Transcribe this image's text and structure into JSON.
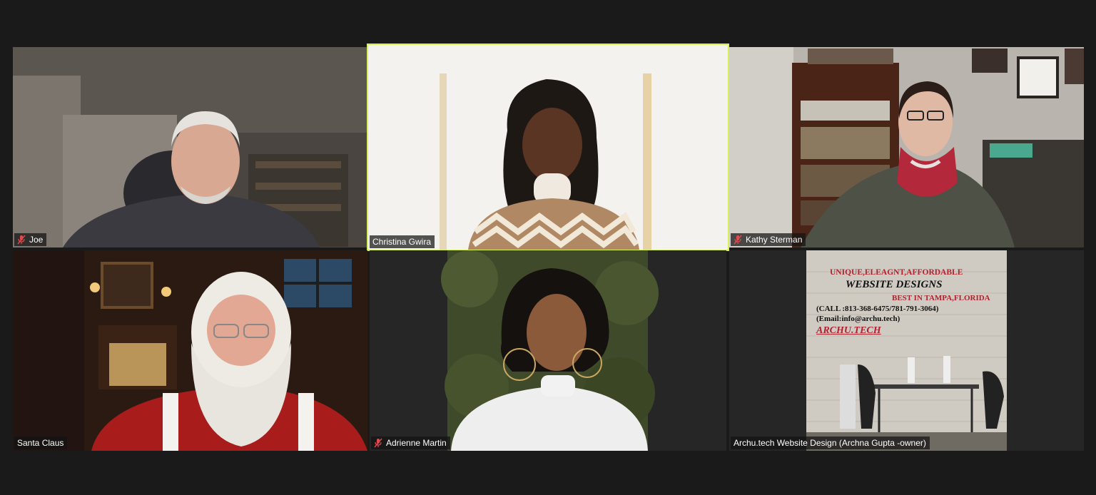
{
  "participants": [
    {
      "name": "Joe",
      "muted": true,
      "active": false
    },
    {
      "name": "Christina Gwira",
      "muted": false,
      "active": true
    },
    {
      "name": "Kathy Sterman",
      "muted": true,
      "active": false
    },
    {
      "name": "Santa Claus",
      "muted": false,
      "active": false
    },
    {
      "name": "Adrienne Martin",
      "muted": true,
      "active": false
    },
    {
      "name": "Archu.tech Website Design (Archna Gupta -owner)",
      "muted": false,
      "active": false
    }
  ],
  "ad": {
    "line1": "UNIQUE,ELEAGNT,AFFORDABLE",
    "line2": "WEBSITE DESIGNS",
    "line3": "BEST IN TAMPA,FLORIDA",
    "line4": "(CALL :813-368-6475/781-791-3064)",
    "line5": "(Email:info@archu.tech)",
    "line6": "ARCHU.TECH"
  },
  "colors": {
    "background": "#1a1a1a",
    "active_speaker_border": "#d6f05a",
    "mute_icon": "#e5484d"
  },
  "icons": {
    "mute": "microphone-muted-icon"
  }
}
